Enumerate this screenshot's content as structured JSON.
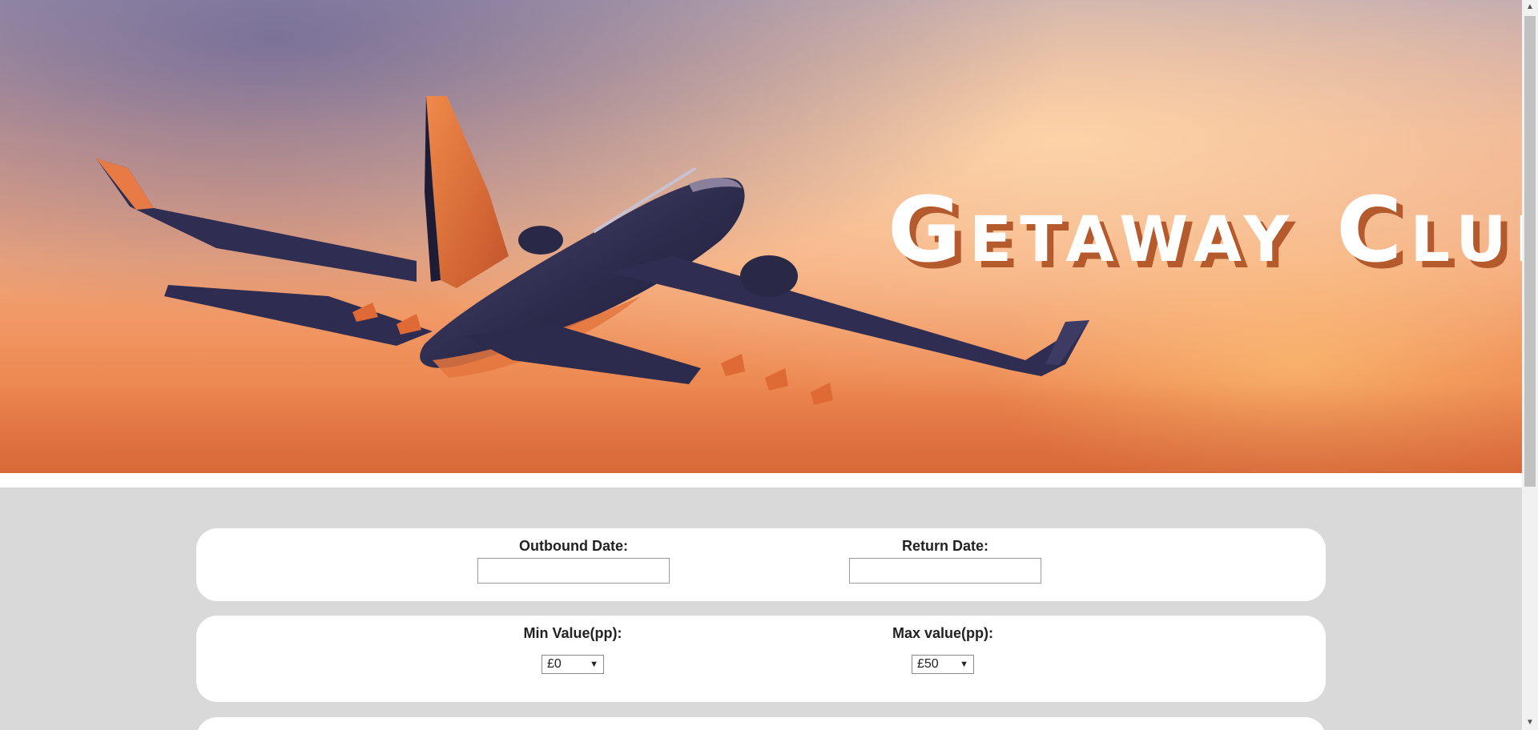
{
  "hero": {
    "brand_title": "Getaway Club"
  },
  "search_form": {
    "dates": {
      "outbound_label": "Outbound Date:",
      "outbound_value": "",
      "return_label": "Return Date:",
      "return_value": ""
    },
    "value": {
      "min_label": "Min Value(pp):",
      "min_selected": "£0",
      "max_label": "Max value(pp):",
      "max_selected": "£50"
    }
  },
  "colors": {
    "page_background": "#d9d9d9",
    "card_background": "#ffffff",
    "brand_shadow": "#b55a2c"
  },
  "icons": {
    "select_arrow": "chevron-down-icon",
    "scroll_up": "scroll-up-arrow-icon",
    "scroll_down": "scroll-down-arrow-icon"
  }
}
